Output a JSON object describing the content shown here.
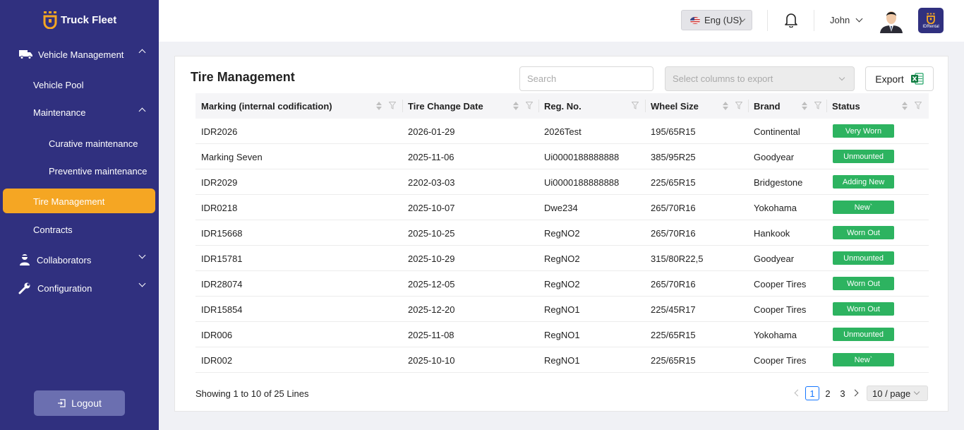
{
  "app": {
    "name": "Truck Fleet"
  },
  "sidebar": {
    "items": [
      {
        "label": "Vehicle Management"
      },
      {
        "label": "Vehicle Pool"
      },
      {
        "label": "Maintenance"
      },
      {
        "label": "Curative maintenance"
      },
      {
        "label": "Preventive maintenance"
      },
      {
        "label": "Tire Management"
      },
      {
        "label": "Contracts"
      },
      {
        "label": "Collaborators"
      },
      {
        "label": "Configuration"
      }
    ],
    "active": "Tire Management",
    "logout_label": "Logout"
  },
  "topbar": {
    "language": "Eng (US)",
    "user_name": "John",
    "badge_text": "IDRental"
  },
  "page": {
    "title": "Tire Management",
    "search_placeholder": "Search",
    "columns_select_placeholder": "Select columns to export",
    "export_label": "Export"
  },
  "table": {
    "columns": [
      "Marking (internal codification)",
      "Tire Change Date",
      "Reg. No.",
      "Wheel Size",
      "Brand",
      "Status"
    ],
    "rows": [
      [
        "IDR2026",
        "2026-01-29",
        "2026Test",
        "195/65R15",
        "Continental",
        "Very Worn"
      ],
      [
        "Marking Seven",
        "2025-11-06",
        "Ui0000188888888",
        "385/95R25",
        "Goodyear",
        "Unmounted"
      ],
      [
        "IDR2029",
        "2202-03-03",
        "Ui0000188888888",
        "225/65R15",
        "Bridgestone",
        "Adding New"
      ],
      [
        "IDR0218",
        "2025-10-07",
        "Dwe234",
        "265/70R16",
        "Yokohama",
        "New`"
      ],
      [
        "IDR15668",
        "2025-10-25",
        "RegNO2",
        "265/70R16",
        "Hankook",
        "Worn Out"
      ],
      [
        "IDR15781",
        "2025-10-29",
        "RegNO2",
        "315/80R22,5",
        "Goodyear",
        "Unmounted"
      ],
      [
        "IDR28074",
        "2025-12-05",
        "RegNO2",
        "265/70R16",
        "Cooper Tires",
        "Worn Out"
      ],
      [
        "IDR15854",
        "2025-12-20",
        "RegNO1",
        "225/45R17",
        "Cooper Tires",
        "Worn Out"
      ],
      [
        "IDR006",
        "2025-11-08",
        "RegNO1",
        "225/65R15",
        "Yokohama",
        "Unmounted"
      ],
      [
        "IDR002",
        "2025-10-10",
        "RegNO1",
        "225/65R15",
        "Cooper Tires",
        "New`"
      ]
    ],
    "status_color": "#2db360"
  },
  "footer": {
    "showing": "Showing 1 to 10 of 25 Lines",
    "pages": [
      "1",
      "2",
      "3"
    ],
    "current_page": "1",
    "page_size": "10 / page"
  },
  "colors": {
    "sidebar": "#30307f",
    "accent": "#f5a623"
  }
}
